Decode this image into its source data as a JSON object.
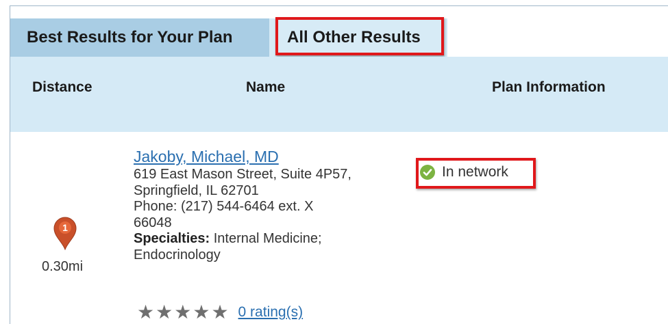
{
  "tabs": [
    {
      "label": "Best Results for Your Plan"
    },
    {
      "label": "All Other Results"
    }
  ],
  "columns": {
    "distance": "Distance",
    "name": "Name",
    "plan": "Plan Information"
  },
  "result": {
    "marker_number": "1",
    "distance": "0.30mi",
    "name": "Jakoby, Michael, MD",
    "address_lines": [
      "619 East Mason Street, Suite 4P57,",
      "Springfield, IL 62701",
      "Phone: (217) 544-6464 ext. X",
      "66048"
    ],
    "specialties_label": "Specialties:",
    "specialties_line1": " Internal Medicine;",
    "specialties_line2": "Endocrinology",
    "network_status": "In network",
    "star_count": 5,
    "filled_stars": 0,
    "rating_link": "0 rating(s)"
  },
  "colors": {
    "active_tab": "#a9cde4",
    "header_bg": "#d5eaf6",
    "highlight": "#e0181b",
    "link": "#2a6fb0",
    "pin": "#c9502a",
    "check": "#7cb342"
  },
  "icons": {
    "pin": "map-pin-icon",
    "check": "checkmark-icon",
    "star": "star-icon"
  }
}
